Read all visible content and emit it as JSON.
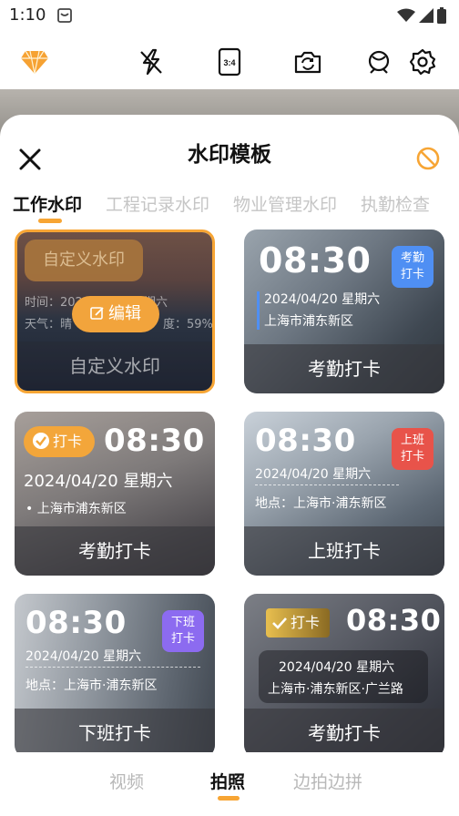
{
  "status_bar": {
    "time": "1:10"
  },
  "sheet": {
    "title": "水印模板",
    "tabs": [
      {
        "label": "工作水印",
        "active": true
      },
      {
        "label": "工程记录水印",
        "active": false
      },
      {
        "label": "物业管理水印",
        "active": false
      },
      {
        "label": "执勤检查",
        "active": false
      }
    ]
  },
  "cards": {
    "custom": {
      "label_tag": "自定义水印",
      "time_line": "时间：2024/04/20 星期六",
      "weather_line_a": "天气：晴",
      "weather_line_b": "度：59%",
      "edit_button": "编辑",
      "footer": "自定义水印"
    },
    "attendance_1": {
      "time": "08:30",
      "badge_line1": "考勤",
      "badge_line2": "打卡",
      "date": "2024/04/20 星期六",
      "location": "上海市浦东新区",
      "footer": "考勤打卡"
    },
    "attendance_2": {
      "pill": "打卡",
      "time": "08:30",
      "date": "2024/04/20 星期六",
      "location": "上海市浦东新区",
      "footer": "考勤打卡"
    },
    "work_on": {
      "time": "08:30",
      "badge_line1": "上班",
      "badge_line2": "打卡",
      "date": "2024/04/20 星期六",
      "location": "地点：上海市·浦东新区",
      "footer": "上班打卡"
    },
    "work_off": {
      "time": "08:30",
      "badge_line1": "下班",
      "badge_line2": "打卡",
      "date": "2024/04/20 星期六",
      "location": "地点：上海市·浦东新区",
      "footer": "下班打卡"
    },
    "attendance_3": {
      "pill": "打卡",
      "time": "08:30",
      "date": "2024/04/20 星期六",
      "location": "上海市·浦东新区·广兰路",
      "footer": "考勤打卡"
    }
  },
  "modes": [
    {
      "label": "视频",
      "active": false
    },
    {
      "label": "拍照",
      "active": true
    },
    {
      "label": "边拍边拼",
      "active": false
    }
  ],
  "colors": {
    "accent": "#f7a534",
    "badge_blue": "#4f8ff3",
    "badge_red": "#e8534a",
    "badge_purple": "#8c6bf0",
    "card_footer": "#4a4a50"
  }
}
